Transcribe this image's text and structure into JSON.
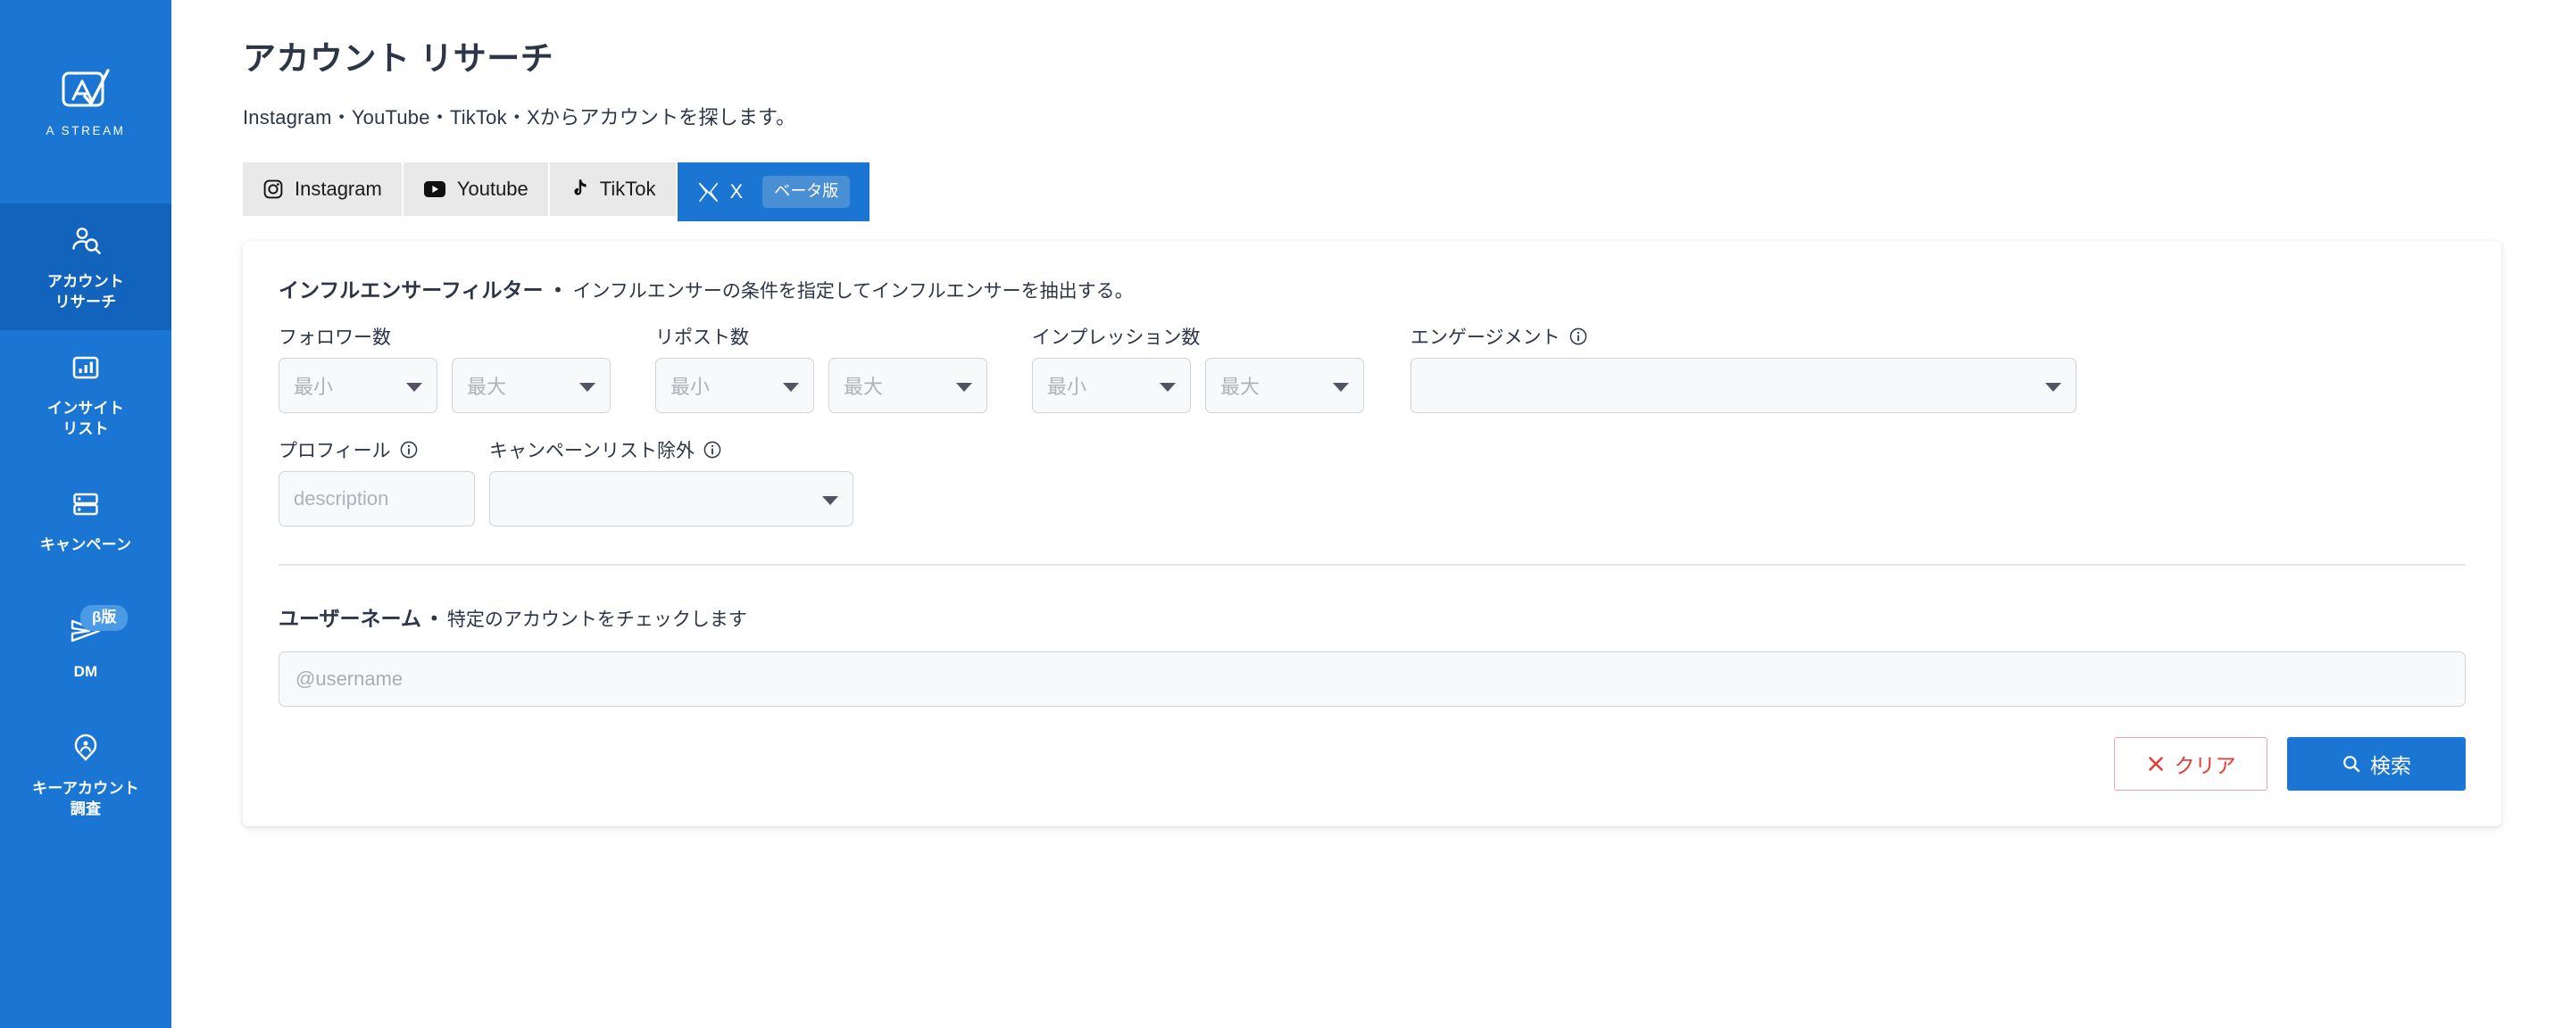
{
  "colors": {
    "brand_blue": "#1a76d2",
    "brand_blue_active": "#1263bb",
    "beta_badge": "#4a9ae6",
    "text_dark": "#2c3647",
    "danger": "#e53935",
    "field_border": "#d0d3d7",
    "tab_inactive_bg": "#e9e9e9"
  },
  "sidebar": {
    "brand": {
      "name": "A STREAM",
      "logo_icon": "a-stream-logo-icon"
    },
    "items": [
      {
        "id": "account-research",
        "label": "アカウント\nリサーチ",
        "label_lines": [
          "アカウント",
          "リサーチ"
        ],
        "icon": "person-search-icon",
        "active": true,
        "badge": null
      },
      {
        "id": "insight-list",
        "label": "インサイト\nリスト",
        "label_lines": [
          "インサイト",
          "リスト"
        ],
        "icon": "bar-chart-icon",
        "active": false,
        "badge": null
      },
      {
        "id": "campaign",
        "label": "キャンペーン",
        "label_lines": [
          "キャンペーン"
        ],
        "icon": "server-list-icon",
        "active": false,
        "badge": null
      },
      {
        "id": "dm",
        "label": "DM",
        "label_lines": [
          "DM"
        ],
        "icon": "send-paper-plane-icon",
        "active": false,
        "badge": "β版"
      },
      {
        "id": "key-account-research",
        "label": "キーアカウント\n調査",
        "label_lines": [
          "キーアカウント",
          "調査"
        ],
        "icon": "location-person-pin-icon",
        "active": false,
        "badge": null
      }
    ]
  },
  "header": {
    "title": "アカウント リサーチ",
    "subtitle": "Instagram・YouTube・TikTok・Xからアカウントを探します。"
  },
  "tabs": [
    {
      "id": "instagram",
      "label": "Instagram",
      "icon": "instagram-icon",
      "active": false,
      "badge": null
    },
    {
      "id": "youtube",
      "label": "Youtube",
      "icon": "youtube-icon",
      "active": false,
      "badge": null
    },
    {
      "id": "tiktok",
      "label": "TikTok",
      "icon": "tiktok-icon",
      "active": false,
      "badge": null
    },
    {
      "id": "x",
      "label": "X",
      "icon": "x-twitter-icon",
      "active": true,
      "badge": "ベータ版"
    }
  ],
  "influencer_filter": {
    "heading_strong": "インフルエンサーフィルター",
    "heading_dot": "・",
    "heading_desc": "インフルエンサーの条件を指定してインフルエンサーを抽出する。",
    "fields": {
      "followers": {
        "label": "フォロワー数",
        "min": {
          "value": "",
          "placeholder": "最小"
        },
        "max": {
          "value": "",
          "placeholder": "最大"
        }
      },
      "reposts": {
        "label": "リポスト数",
        "min": {
          "value": "",
          "placeholder": "最小"
        },
        "max": {
          "value": "",
          "placeholder": "最大"
        }
      },
      "impressions": {
        "label": "インプレッション数",
        "min": {
          "value": "",
          "placeholder": "最小"
        },
        "max": {
          "value": "",
          "placeholder": "最大"
        }
      },
      "engagement": {
        "label": "エンゲージメント",
        "has_info": true,
        "select": {
          "value": "",
          "placeholder": ""
        }
      },
      "profile": {
        "label": "プロフィール",
        "has_info": true,
        "input": {
          "value": "",
          "placeholder": "description"
        }
      },
      "campaign_exclude": {
        "label": "キャンペーンリスト除外",
        "has_info": true,
        "select": {
          "value": "",
          "placeholder": ""
        }
      }
    }
  },
  "username_section": {
    "heading_strong": "ユーザーネーム",
    "heading_dot": "・",
    "heading_desc": "特定のアカウントをチェックします",
    "input": {
      "value": "",
      "placeholder": "@username"
    }
  },
  "actions": {
    "clear": {
      "label": "クリア",
      "icon": "close-x-icon"
    },
    "search": {
      "label": "検索",
      "icon": "search-icon"
    }
  }
}
